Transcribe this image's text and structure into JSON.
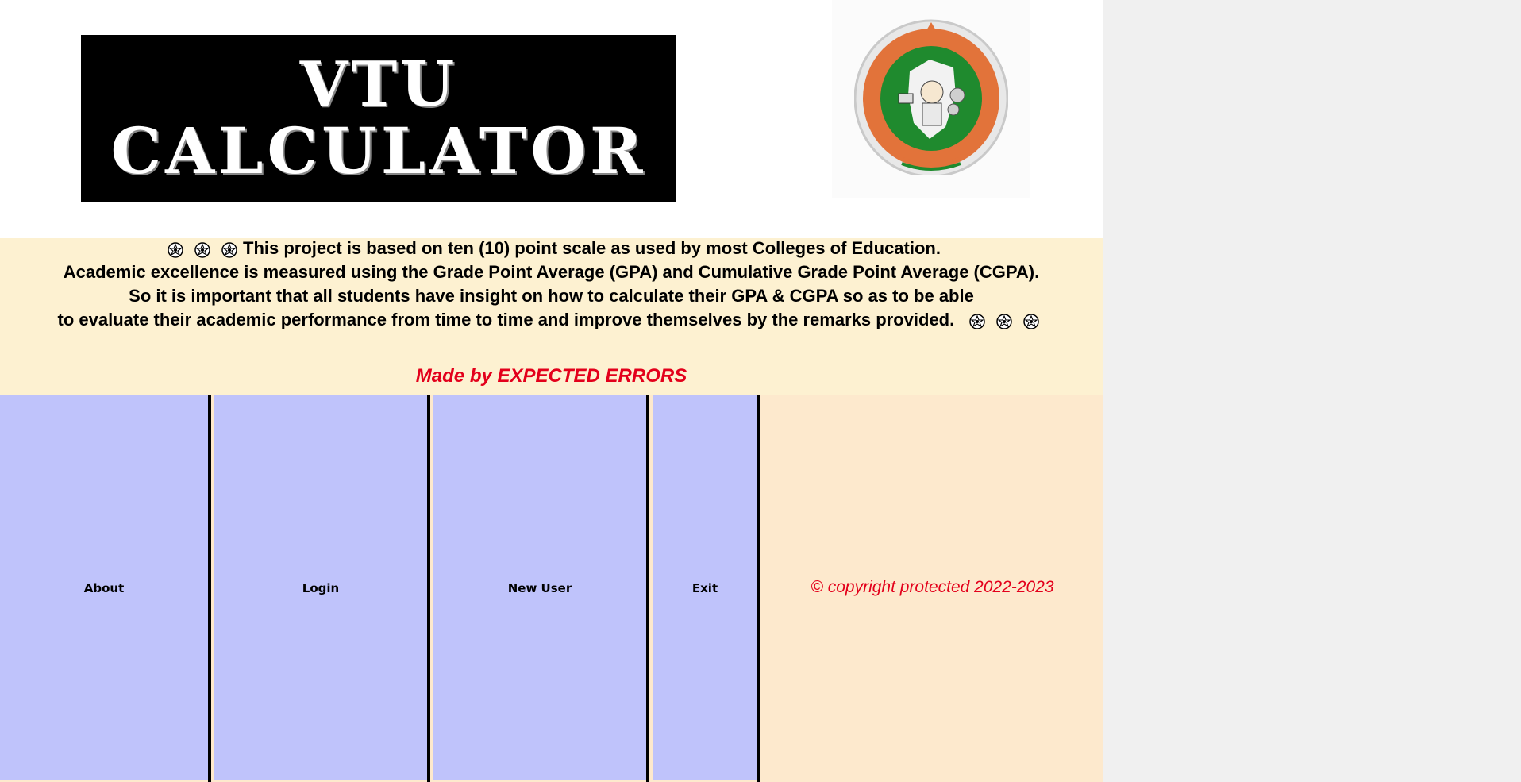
{
  "banner": {
    "line1": "VTU",
    "line2": "CALCULATOR"
  },
  "logo": {
    "name": "vtu-emblem",
    "colors": {
      "ring": "#e2733a",
      "inner": "#1f8a2e",
      "edge": "#c9c9c9"
    }
  },
  "info": {
    "line1": "This project is based on ten (10) point scale as used by most  Colleges of Education.",
    "line2": "Academic excellence is measured using the Grade Point Average (GPA) and Cumulative Grade Point Average (CGPA).",
    "line3": "So it is important that all students have insight on how to calculate their GPA & CGPA so as to be able",
    "line4": "to evaluate their academic performance from time to time and improve themselves by the remarks provided.",
    "made_by": "Made by EXPECTED ERRORS",
    "decor_icon": "flower-icon"
  },
  "buttons": {
    "about": "About",
    "login": "Login",
    "new_user": "New User",
    "exit": "Exit"
  },
  "footer": {
    "copyright": "© copyright protected 2022-2023"
  },
  "colors": {
    "button_bg": "#bfc3fb",
    "info_bg": "#fdf1d1",
    "footer_bg": "#fde9cd",
    "accent_red": "#e3001b"
  }
}
